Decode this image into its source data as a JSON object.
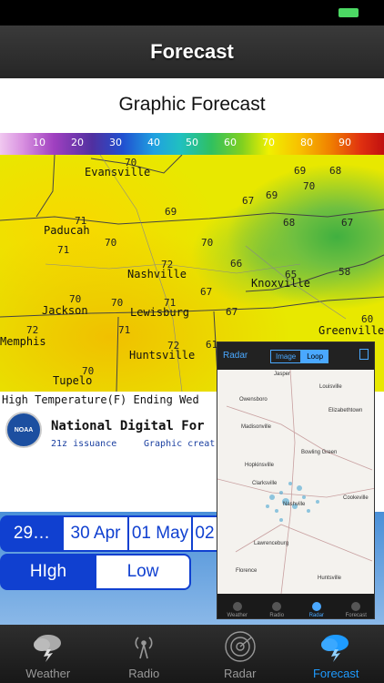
{
  "nav": {
    "title": "Forecast"
  },
  "page": {
    "heading": "Graphic Forecast"
  },
  "scale": {
    "labels": [
      "10",
      "20",
      "30",
      "40",
      "50",
      "60",
      "70",
      "80",
      "90"
    ]
  },
  "map": {
    "cities": [
      "Evansville",
      "Paducah",
      "Nashville",
      "Knoxville",
      "Jackson",
      "Lewisburg",
      "Memphis",
      "Huntsville",
      "Tupelo",
      "Greenville"
    ],
    "temps": [
      "70",
      "69",
      "68",
      "70",
      "67",
      "69",
      "68",
      "67",
      "69",
      "71",
      "71",
      "70",
      "70",
      "72",
      "66",
      "65",
      "58",
      "70",
      "70",
      "71",
      "67",
      "67",
      "60",
      "72",
      "71",
      "72",
      "61",
      "70"
    ]
  },
  "caption": "High Temperature(F) Ending Wed",
  "ndfd": {
    "logo_text": "NOAA",
    "title": "National Digital For",
    "issuance": "21z issuance",
    "credit": "Graphic creat"
  },
  "dates": [
    "29…",
    "30 Apr",
    "01 May",
    "02"
  ],
  "types": [
    "HIgh",
    "Low"
  ],
  "radar_thumb": {
    "back": "Radar",
    "seg_image": "Image",
    "seg_loop": "Loop",
    "places": [
      "Jasper",
      "Louisville",
      "Owensboro",
      "Elizabethtown",
      "Madisonville",
      "Bowling Green",
      "Hopkinsville",
      "Clarksville",
      "Nashville",
      "Cookeville",
      "Lawrenceburg",
      "Florence",
      "Huntsville"
    ],
    "tabs": [
      "Weather",
      "Radio",
      "Radar",
      "Forecast"
    ]
  },
  "tabs": [
    "Weather",
    "Radio",
    "Radar",
    "Forecast"
  ]
}
